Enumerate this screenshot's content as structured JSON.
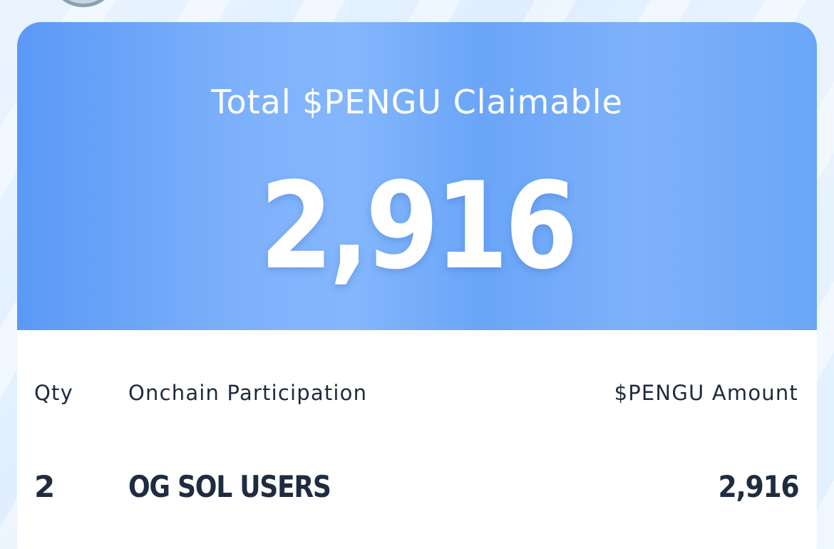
{
  "summary": {
    "title": "Total $PENGU Claimable",
    "total_amount": "2,916"
  },
  "table": {
    "headers": {
      "qty": "Qty",
      "participation": "Onchain Participation",
      "amount": "$PENGU Amount"
    },
    "rows": [
      {
        "qty": "2",
        "participation": "OG SOL USERS",
        "amount": "2,916"
      }
    ]
  },
  "colors": {
    "hero_gradient_start": "#5b99f7",
    "hero_gradient_mid": "#84b6fc",
    "text_dark": "#1f2c40",
    "card_background": "#ffffff",
    "page_background": "#e6f2ff"
  }
}
